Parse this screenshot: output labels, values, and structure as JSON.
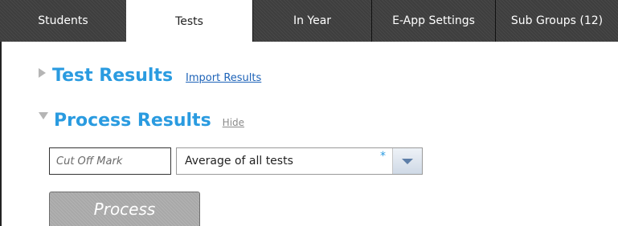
{
  "tabs": [
    {
      "label": "Students",
      "active": false
    },
    {
      "label": "Tests",
      "active": true
    },
    {
      "label": "In Year",
      "active": false
    },
    {
      "label": "E-App Settings",
      "active": false
    },
    {
      "label": "Sub Groups  (12)",
      "active": false
    }
  ],
  "sections": {
    "test_results": {
      "title": "Test Results",
      "link": "Import Results",
      "icon": "collapsed-triangle-icon"
    },
    "process_results": {
      "title": "Process Results",
      "link": "Hide",
      "icon": "expanded-triangle-icon"
    }
  },
  "form": {
    "cutoff_placeholder": "Cut Off Mark",
    "cutoff_value": "",
    "average_select": {
      "selected": "Average of all tests",
      "required_marker": "*"
    },
    "process_button": "Process"
  },
  "colors": {
    "accent": "#2a9be0",
    "link": "#1e63b8",
    "tab_bg": "#3e3e3e",
    "button_disabled": "#a8a8a8"
  }
}
